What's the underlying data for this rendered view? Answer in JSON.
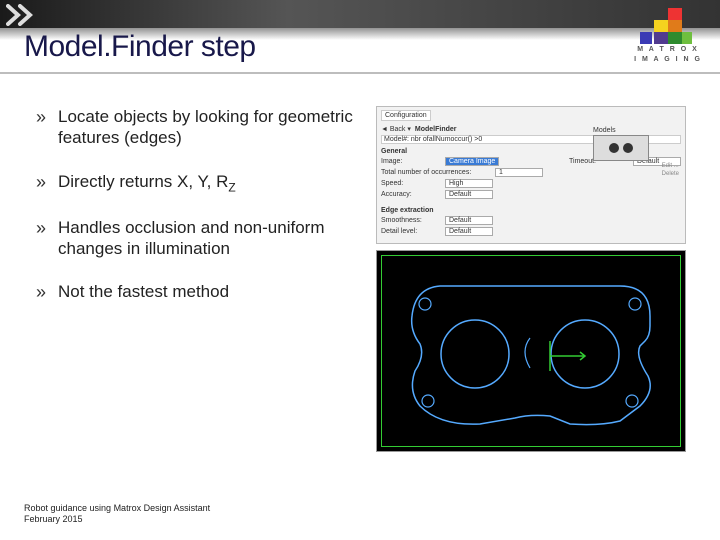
{
  "header": {
    "title": "Model.Finder step",
    "logo_line1": "M A T R O X",
    "logo_line2": "I M A G I N G"
  },
  "bullets": [
    "Locate objects by looking for geometric features (edges)",
    "Directly returns X, Y, R",
    "Handles occlusion and non-uniform changes in illumination",
    "Not the fastest method"
  ],
  "bullet2_sub": "Z",
  "panel": {
    "config_label": "Configuration",
    "back": "Back",
    "crumb": "ModelFinder",
    "path": "Model#: nbr   ofallNumoccur() >0",
    "general": "General",
    "image_label": "Image:",
    "image_value": "Camera Image",
    "timeout_label": "Timeout:",
    "timeout_value": "Default",
    "max_label": "Total number of occurrences:",
    "max_value": "1",
    "models_label": "Models",
    "speed_label": "Speed:",
    "speed_value": "High",
    "accuracy_label": "Accuracy:",
    "accuracy_value": "Default",
    "edge_sec": "Edge extraction",
    "smooth_label": "Smoothness:",
    "smooth_value": "Default",
    "detail_label": "Detail level:",
    "detail_value": "Default",
    "r_edit": "Edit ...",
    "r_delete": "Delete"
  },
  "footer": {
    "line1": "Robot guidance using Matrox Design Assistant",
    "line2": "February 2015"
  }
}
